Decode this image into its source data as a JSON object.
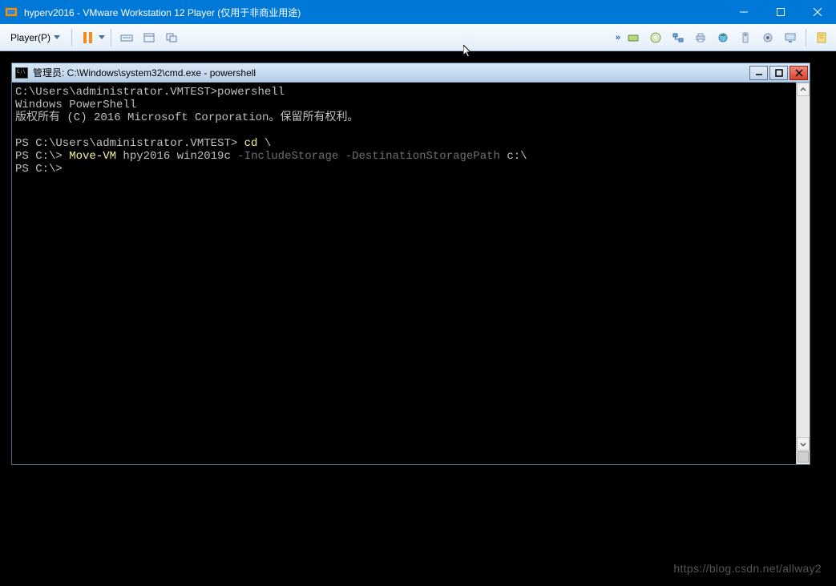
{
  "vmware": {
    "title": "hyperv2016 - VMware Workstation 12 Player (仅用于非商业用途)",
    "menu_player": "Player(P)"
  },
  "cmd": {
    "title": "管理员: C:\\Windows\\system32\\cmd.exe - powershell",
    "lines": {
      "l1_prompt": "C:\\Users\\administrator.VMTEST>",
      "l1_cmd": "powershell",
      "l2": "Windows PowerShell",
      "l3": "版权所有 (C) 2016 Microsoft Corporation。保留所有权利。",
      "l4": "",
      "l5_prompt": "PS C:\\Users\\administrator.VMTEST>",
      "l5_cmd": " cd",
      "l5_arg": " \\",
      "l6_prompt": "PS C:\\>",
      "l6_cmd": " Move-VM",
      "l6_args1": " hpy2016 win2019c",
      "l6_params": " -IncludeStorage -DestinationStoragePath",
      "l6_args2": " c:\\",
      "l7_prompt": "PS C:\\>"
    }
  },
  "watermark": "https://blog.csdn.net/allway2"
}
